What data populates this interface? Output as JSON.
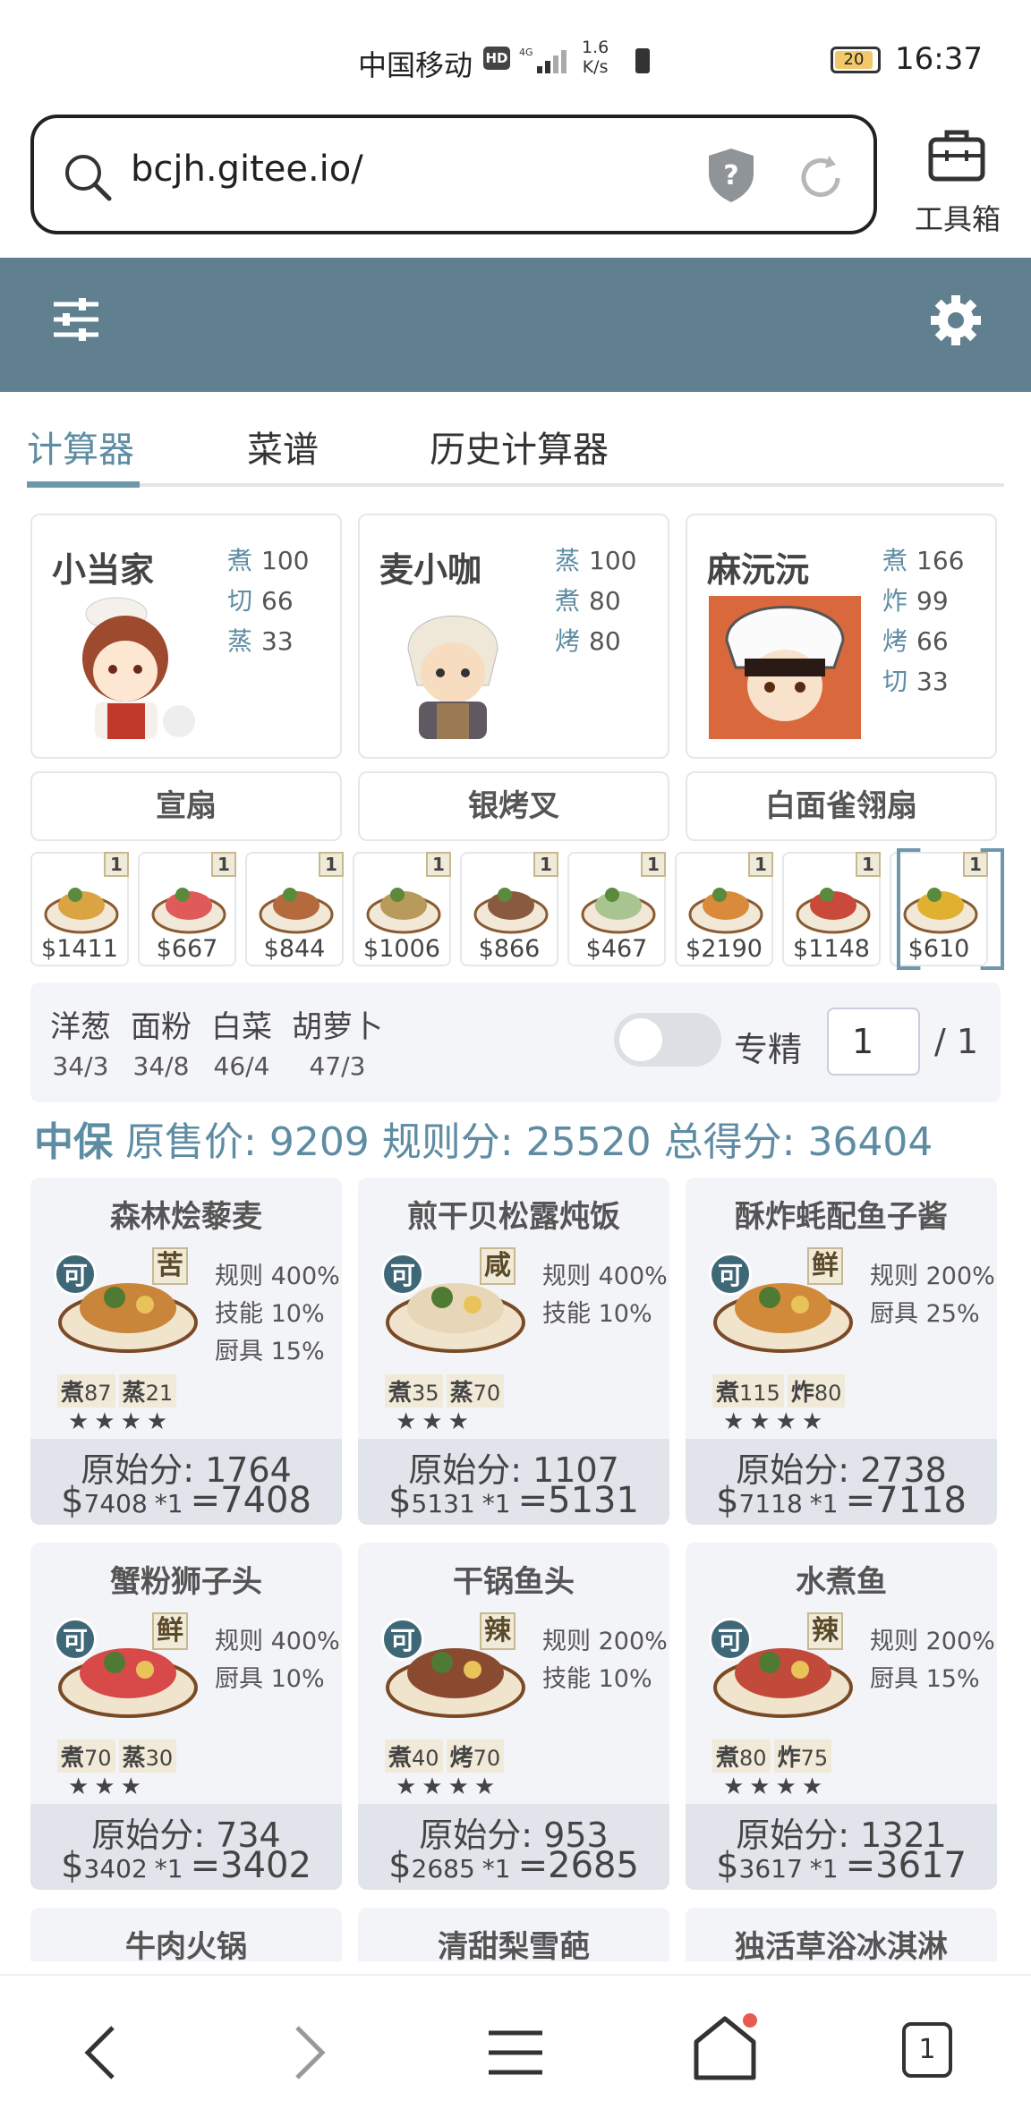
{
  "status": {
    "carrier": "中国移动",
    "hd": "HD",
    "speed_value": "1.6",
    "speed_unit": "K/s",
    "battery": "20",
    "time": "16:37"
  },
  "browser": {
    "url": "bcjh.gitee.io/",
    "toolbox_label": "工具箱"
  },
  "tabs": [
    {
      "label": "计算器"
    },
    {
      "label": "菜谱"
    },
    {
      "label": "历史计算器"
    }
  ],
  "chefs": [
    {
      "name": "小当家",
      "skills": [
        {
          "k": "煮",
          "v": "100"
        },
        {
          "k": "切",
          "v": "66"
        },
        {
          "k": "蒸",
          "v": "33"
        }
      ]
    },
    {
      "name": "麦小咖",
      "skills": [
        {
          "k": "蒸",
          "v": "100"
        },
        {
          "k": "煮",
          "v": "80"
        },
        {
          "k": "烤",
          "v": "80"
        }
      ]
    },
    {
      "name": "麻沅沅",
      "skills": [
        {
          "k": "煮",
          "v": "166"
        },
        {
          "k": "炸",
          "v": "99"
        },
        {
          "k": "烤",
          "v": "66"
        },
        {
          "k": "切",
          "v": "33"
        }
      ]
    }
  ],
  "equips": [
    "宣扇",
    "银烤叉",
    "白面雀翎扇"
  ],
  "dish_strip": [
    {
      "count": "1",
      "price": "$1411"
    },
    {
      "count": "1",
      "price": "$667"
    },
    {
      "count": "1",
      "price": "$844"
    },
    {
      "count": "1",
      "price": "$1006"
    },
    {
      "count": "1",
      "price": "$866"
    },
    {
      "count": "1",
      "price": "$467"
    },
    {
      "count": "1",
      "price": "$2190"
    },
    {
      "count": "1",
      "price": "$1148"
    },
    {
      "count": "1",
      "price": "$610"
    }
  ],
  "ingredients": [
    {
      "name": "洋葱",
      "qty": "34/3"
    },
    {
      "name": "面粉",
      "qty": "34/8"
    },
    {
      "name": "白菜",
      "qty": "46/4"
    },
    {
      "name": "胡萝卜",
      "qty": "47/3"
    }
  ],
  "specialize": {
    "label": "专精",
    "value": "1",
    "total": "/ 1",
    "enabled": false
  },
  "score": {
    "tier": "中保",
    "orig_label": "原售价:",
    "orig": "9209",
    "rule_label": "规则分:",
    "rule": "25520",
    "total_label": "总得分:",
    "total": "36404"
  },
  "recipes": [
    {
      "name": "森林烩藜麦",
      "can": "可",
      "taste": "苦",
      "rules": [
        "规则 400%",
        "技能 10%",
        "厨具 15%"
      ],
      "req": [
        {
          "k": "煮",
          "v": "87"
        },
        {
          "k": "蒸",
          "v": "21"
        }
      ],
      "stars": "★★★★",
      "orig": "原始分: 1764",
      "price": "7408",
      "mult": "*1",
      "final": "7408"
    },
    {
      "name": "煎干贝松露炖饭",
      "can": "可",
      "taste": "咸",
      "rules": [
        "规则 400%",
        "技能 10%"
      ],
      "req": [
        {
          "k": "煮",
          "v": "35"
        },
        {
          "k": "蒸",
          "v": "70"
        }
      ],
      "stars": "★★★",
      "orig": "原始分: 1107",
      "price": "5131",
      "mult": "*1",
      "final": "5131"
    },
    {
      "name": "酥炸蚝配鱼子酱",
      "can": "可",
      "taste": "鲜",
      "rules": [
        "规则 200%",
        "厨具 25%"
      ],
      "req": [
        {
          "k": "煮",
          "v": "115"
        },
        {
          "k": "炸",
          "v": "80"
        }
      ],
      "stars": "★★★★",
      "orig": "原始分: 2738",
      "price": "7118",
      "mult": "*1",
      "final": "7118"
    },
    {
      "name": "蟹粉狮子头",
      "can": "可",
      "taste": "鲜",
      "rules": [
        "规则 400%",
        "厨具 10%"
      ],
      "req": [
        {
          "k": "煮",
          "v": "70"
        },
        {
          "k": "蒸",
          "v": "30"
        }
      ],
      "stars": "★★★",
      "orig": "原始分: 734",
      "price": "3402",
      "mult": "*1",
      "final": "3402"
    },
    {
      "name": "干锅鱼头",
      "can": "可",
      "taste": "辣",
      "rules": [
        "规则 200%",
        "技能 10%"
      ],
      "req": [
        {
          "k": "煮",
          "v": "40"
        },
        {
          "k": "烤",
          "v": "70"
        }
      ],
      "stars": "★★★★",
      "orig": "原始分: 953",
      "price": "2685",
      "mult": "*1",
      "final": "2685"
    },
    {
      "name": "水煮鱼",
      "can": "可",
      "taste": "辣",
      "rules": [
        "规则 200%",
        "厨具 15%"
      ],
      "req": [
        {
          "k": "煮",
          "v": "80"
        },
        {
          "k": "炸",
          "v": "75"
        }
      ],
      "stars": "★★★★",
      "orig": "原始分: 1321",
      "price": "3617",
      "mult": "*1",
      "final": "3617"
    }
  ],
  "recipes_partial": [
    "牛肉火锅",
    "清甜梨雪葩",
    "独活草浴冰淇淋"
  ],
  "bottom_nav": {
    "tab_count": "1"
  },
  "colors": {
    "header": "#60808f",
    "accent": "#5e8ca3",
    "badge_dark": "#3e6777"
  }
}
